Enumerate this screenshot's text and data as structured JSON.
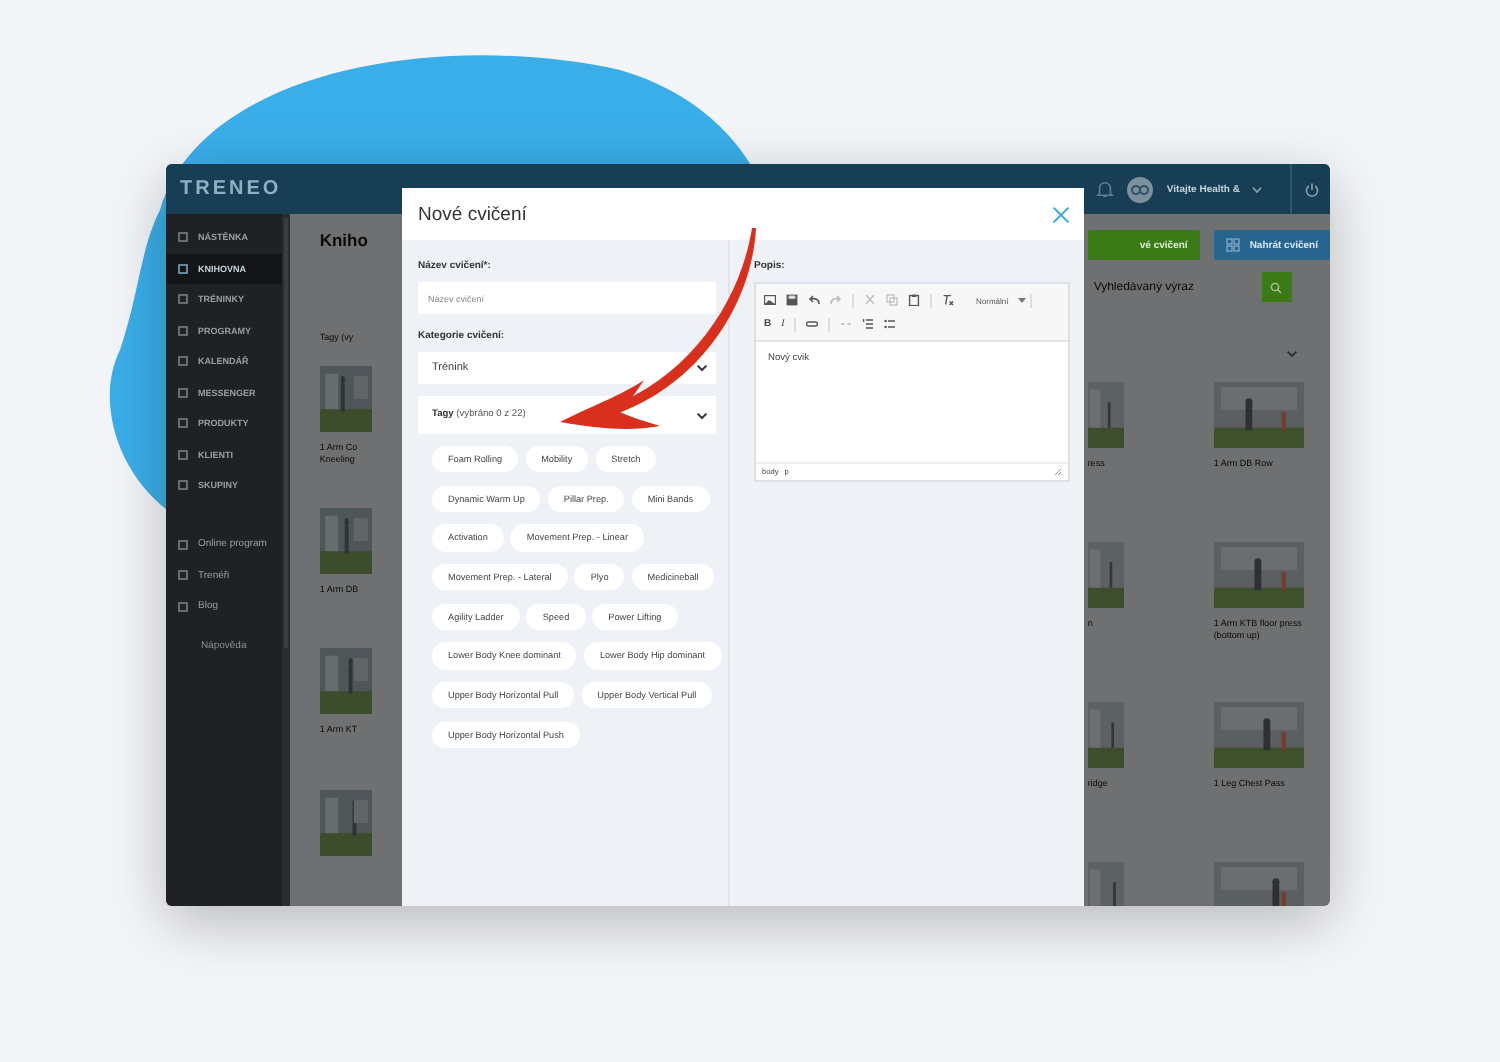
{
  "app": {
    "logo": "TRENEO",
    "greeting": "Vitajte Health &"
  },
  "sidebar": {
    "items": [
      {
        "label": "NÁSTĚNKA",
        "selected": false
      },
      {
        "label": "KNIHOVNA",
        "selected": true
      },
      {
        "label": "TRÉNINKY",
        "selected": false
      },
      {
        "label": "PROGRAMY",
        "selected": false
      },
      {
        "label": "KALENDÁŘ",
        "selected": false
      },
      {
        "label": "MESSENGER",
        "selected": false
      },
      {
        "label": "PRODUKTY",
        "selected": false
      },
      {
        "label": "KLIENTI",
        "selected": false
      },
      {
        "label": "SKUPINY",
        "selected": false
      }
    ],
    "links": [
      {
        "label": "Online program"
      },
      {
        "label": "Trenéři"
      },
      {
        "label": "Blog"
      }
    ],
    "help": "Nápověda"
  },
  "content": {
    "title": "Kniho",
    "add_button": "vé cvičení",
    "upload_button": "Nahrát cvičení",
    "search": {
      "placeholder": "Vyhledávaný výraz"
    },
    "filter": "Tagy (vy",
    "cards_left": [
      {
        "kind": "exercise",
        "title": "1 Arm Co Kneeling"
      },
      {
        "kind": "exercise",
        "title": "1 Arm DB"
      },
      {
        "kind": "exercise",
        "title": "1 Arm KT"
      },
      {
        "kind": "picture"
      }
    ],
    "cards_mid": [
      {
        "kind": "exercise",
        "title": "ress"
      },
      {
        "kind": "exercise",
        "title": "n"
      },
      {
        "kind": "exercise",
        "title": "ridge"
      },
      {
        "kind": "picture"
      }
    ],
    "cards_right": [
      {
        "kind": "exercise",
        "title": "1 Arm DB Row"
      },
      {
        "kind": "exercise",
        "title": "1 Arm KTB floor press (bottom up)"
      },
      {
        "kind": "exercise",
        "title": "1 Leg Chest Pass"
      },
      {
        "kind": "picture"
      }
    ]
  },
  "modal": {
    "title": "Nové cvičení",
    "name_label": "Název cvičení*:",
    "name_field": {
      "placeholder": "Název cvičení"
    },
    "category_label": "Kategorie cvičení:",
    "category": "Trénink",
    "tags_title": "Tagy",
    "tags_count": "(vybráno 0 z 22)",
    "tags_expanded": true,
    "tags": [
      "Foam Rolling",
      "Mobility",
      "Stretch",
      "Dynamic Warm Up",
      "Pillar Prep.",
      "Mini Bands",
      "Activation",
      "Movement Prep. - Linear",
      "Movement Prep. - Lateral",
      "Plyo",
      "Medicineball",
      "Agility Ladder",
      "Speed",
      "Power Lifting",
      "Lower Body Knee dominant",
      "Lower Body Hip dominant",
      "Upper Body Horizontal Pull",
      "Upper Body Vertical Pull",
      "Upper Body Horizontal Push"
    ],
    "description_label": "Popis:",
    "format": "Normální",
    "bold_key": "B",
    "italic_key": "I",
    "editor_text": "Nový cvik",
    "editor_path": [
      "body",
      "p"
    ]
  }
}
